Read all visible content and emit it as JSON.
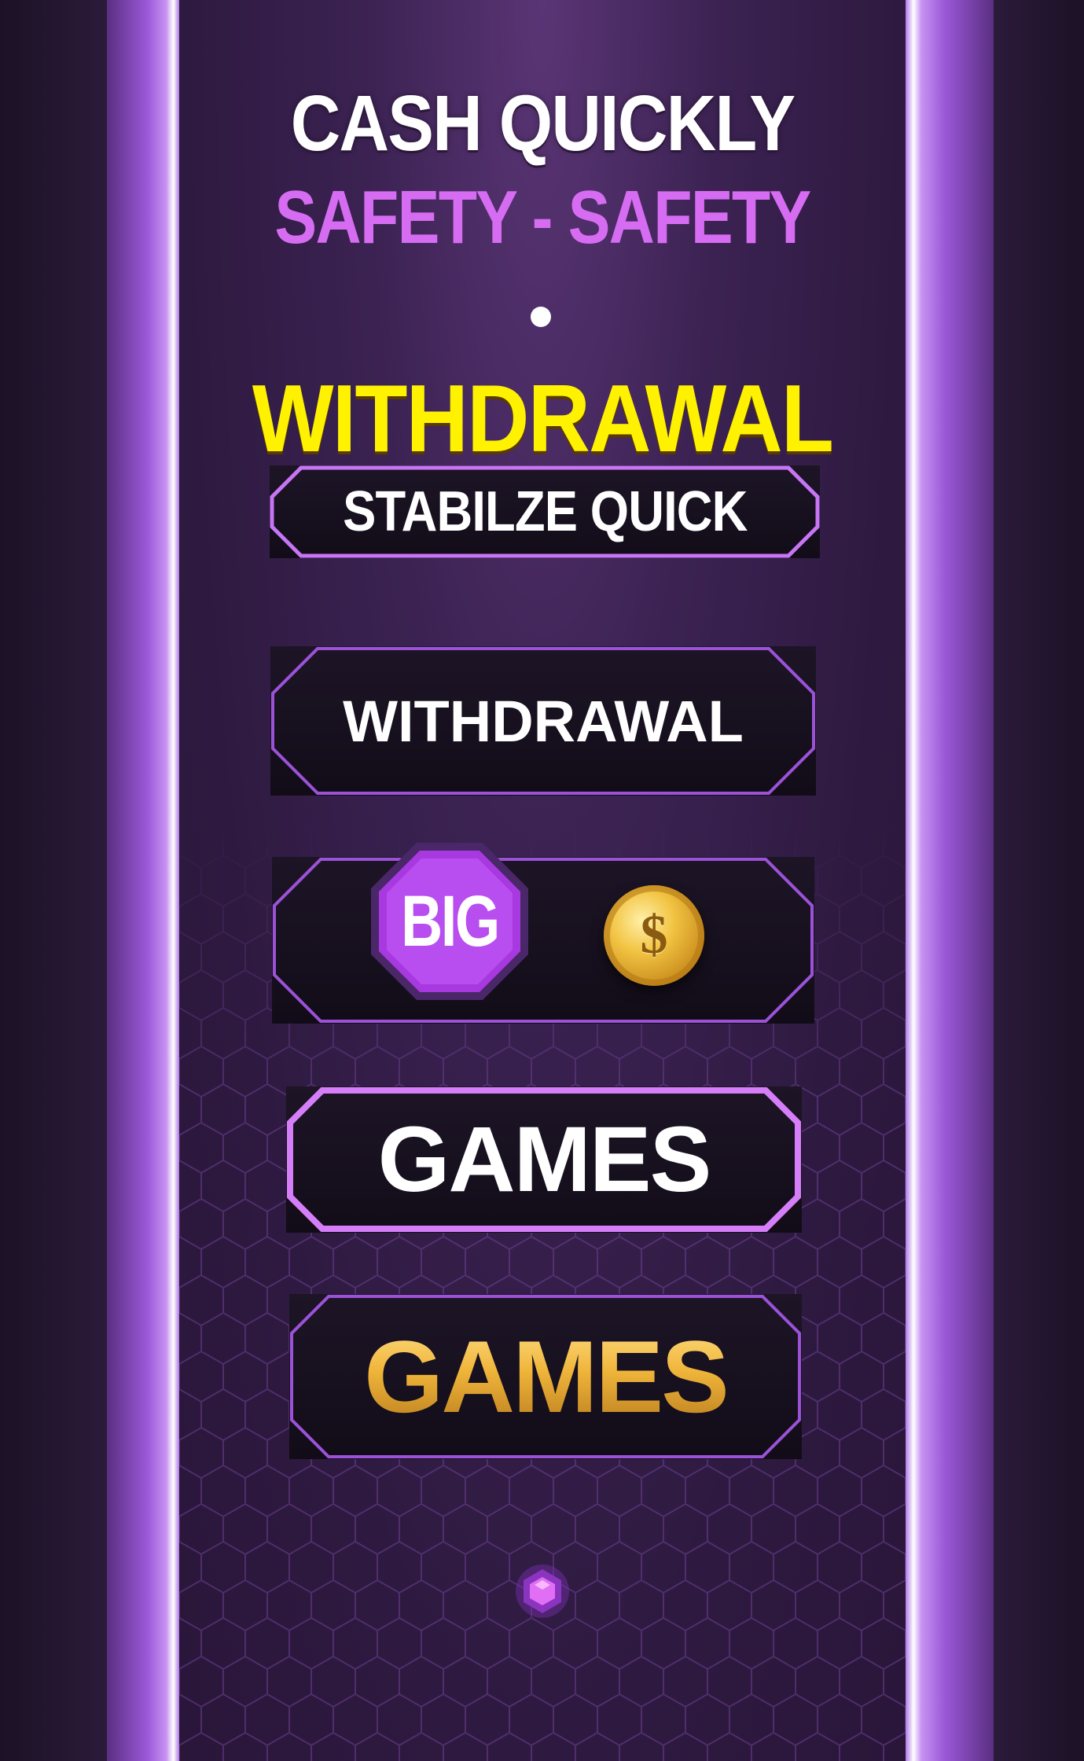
{
  "header": {
    "line1": "CASH QUICKLY",
    "line2": "SAFETY - SAFETY",
    "headline": "WITHDRAWAL"
  },
  "buttons": {
    "stabilize": "STABILZE QUICK",
    "withdrawal": "WITHDRAWAL",
    "big_badge": "BIG",
    "coin_symbol": "$",
    "games_primary": "GAMES",
    "games_gold": "GAMES"
  },
  "icons": {
    "big_badge": "octagon-badge-icon",
    "coin": "gold-coin-icon",
    "gem": "hexagon-gem-icon",
    "separator": "dot-icon"
  },
  "colors": {
    "background": "#2e1a40",
    "rail": "#9a57d6",
    "accent_purple": "#d66cf2",
    "accent_yellow": "#fff200",
    "gold": "#e6b43c",
    "button_fill": "#120c18"
  }
}
